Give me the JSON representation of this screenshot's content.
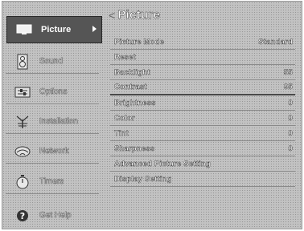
{
  "sidebar": {
    "items": [
      {
        "label": "Picture",
        "icon": "tv-screen-icon",
        "active": true
      },
      {
        "label": "Sound",
        "icon": "speaker-icon"
      },
      {
        "label": "Options",
        "icon": "options-icon"
      },
      {
        "label": "Installation",
        "icon": "antenna-icon"
      },
      {
        "label": "Network",
        "icon": "network-icon"
      },
      {
        "label": "Timers",
        "icon": "timer-icon"
      },
      {
        "label": "Get Help",
        "icon": "help-icon"
      }
    ]
  },
  "panel": {
    "title": "Picture",
    "rows": [
      {
        "label": "Picture Mode",
        "value": "Standard"
      },
      {
        "label": "Reset",
        "value": ""
      },
      {
        "label": "Backlight",
        "value": "55"
      },
      {
        "label": "Contrast",
        "value": "95"
      },
      {
        "label": "Brightness",
        "value": "0"
      },
      {
        "label": "Color",
        "value": "0"
      },
      {
        "label": "Tint",
        "value": "0"
      },
      {
        "label": "Sharpness",
        "value": "0"
      },
      {
        "label": "Advanced Picture Setting",
        "value": ""
      },
      {
        "label": "Display Setting",
        "value": ""
      }
    ]
  }
}
